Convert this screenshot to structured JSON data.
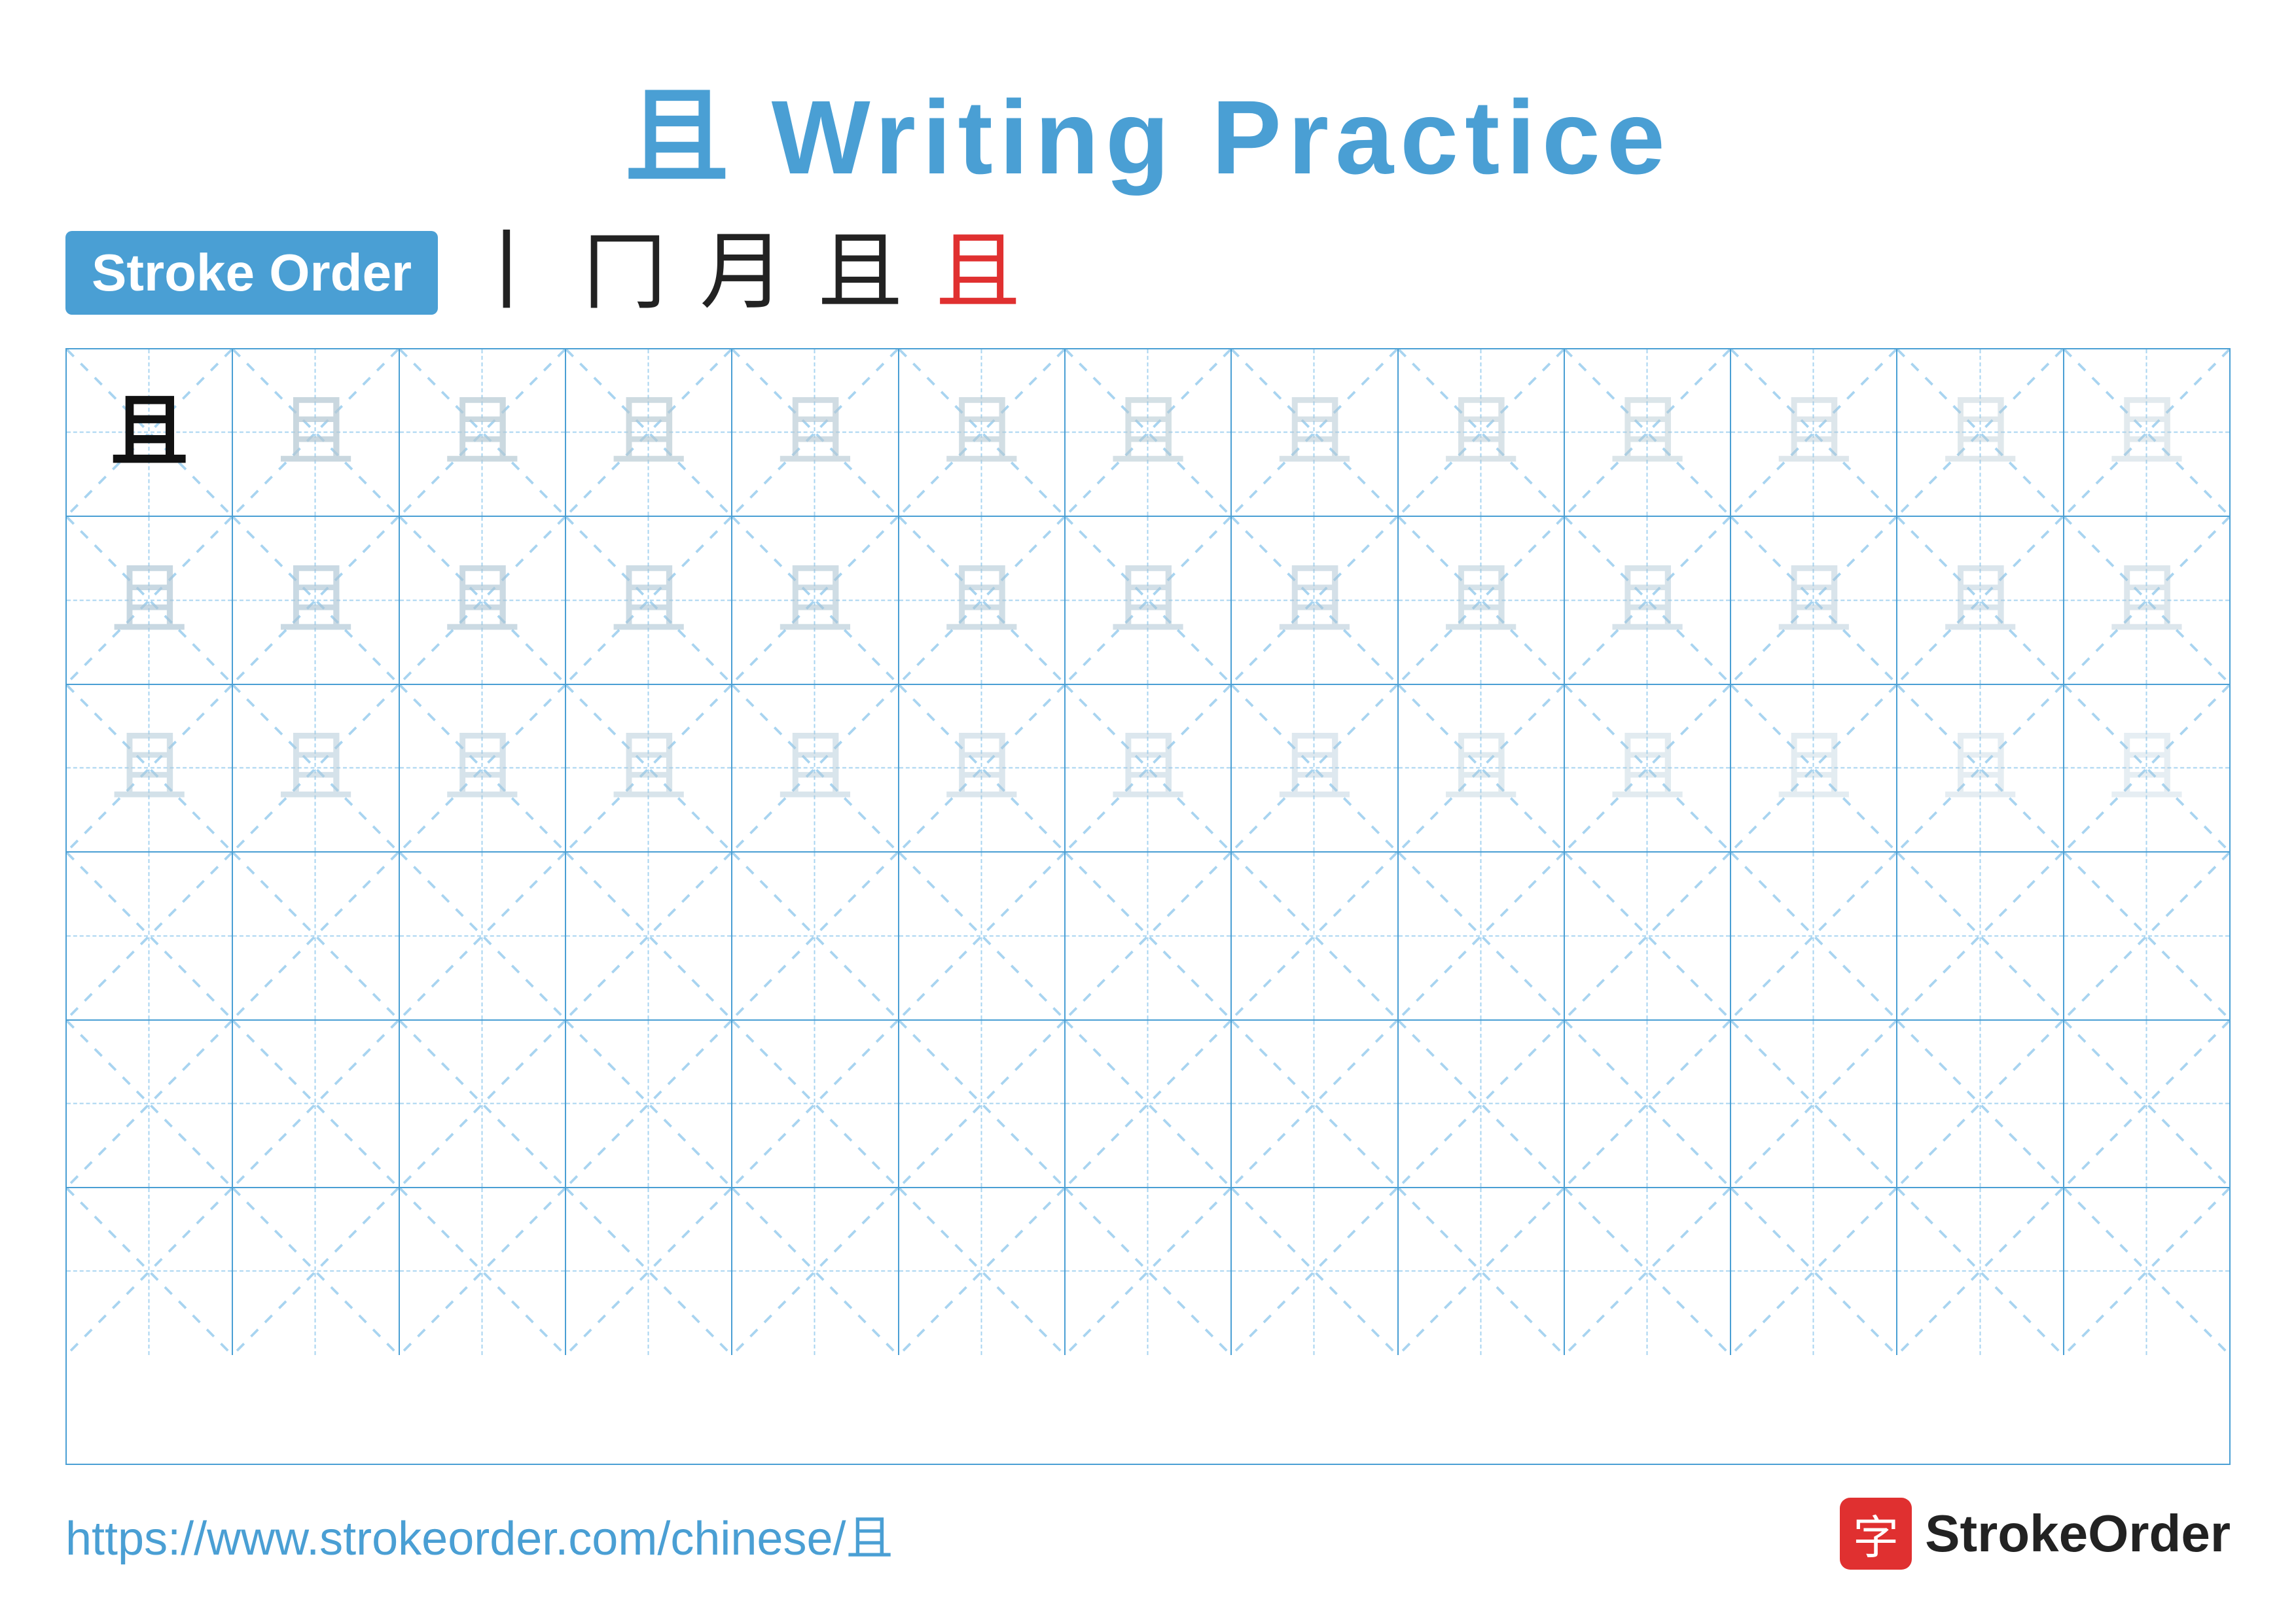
{
  "title": "且 Writing Practice",
  "title_char": "且",
  "title_text": "Writing Practice",
  "stroke_order_label": "Stroke Order",
  "stroke_sequence": [
    "丨",
    "冂",
    "月",
    "且",
    "且"
  ],
  "stroke_sequence_last_red": true,
  "character": "且",
  "rows": 6,
  "cols": 13,
  "practice_rows": [
    {
      "type": "example",
      "fade_from": 2
    },
    {
      "type": "fade_medium"
    },
    {
      "type": "fade_light"
    },
    {
      "type": "empty"
    },
    {
      "type": "empty"
    },
    {
      "type": "empty"
    }
  ],
  "footer_url": "https://www.strokeorder.com/chinese/且",
  "footer_logo_char": "字",
  "footer_logo_name": "StrokeOrder"
}
